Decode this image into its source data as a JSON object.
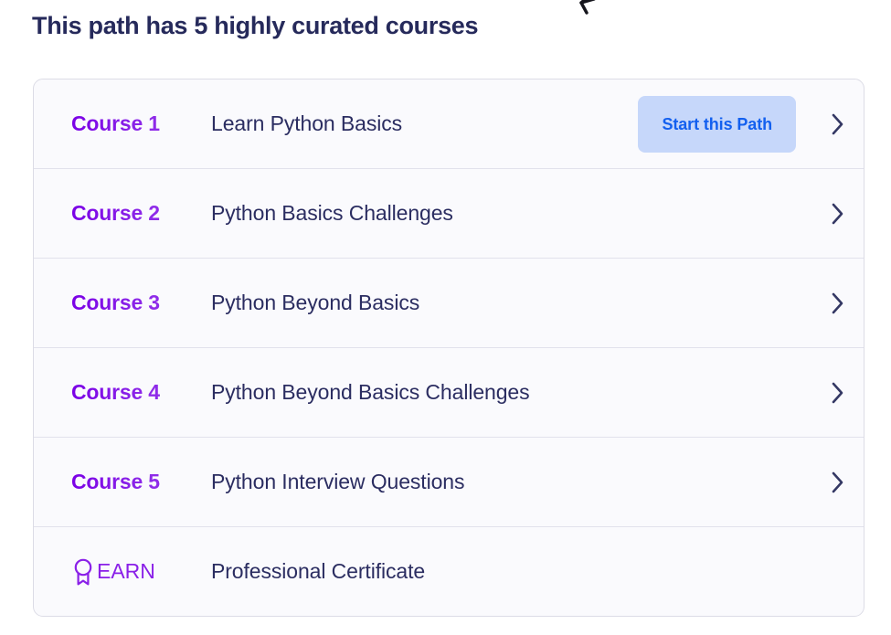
{
  "header": {
    "title": "This path has 5 highly curated courses",
    "decoration_icon": "curved-arrow-icon"
  },
  "colors": {
    "heading_navy": "#262a5b",
    "course_label_purple": "#7a00e6",
    "course_label_violet": "#9b30ee",
    "title_navy": "#2b2d61",
    "button_background": "#c6d7fa",
    "button_text": "#1360ef",
    "card_background": "#fafafd",
    "card_border": "#dcdce6",
    "row_divider": "#e2e2ec",
    "earn_icon_purple": "#8a20e8"
  },
  "course_list": {
    "rows": [
      {
        "label": "Course 1",
        "title": "Learn Python Basics",
        "button_label": "Start this Path",
        "has_button": true,
        "chevron_icon": "chevron-right-icon"
      },
      {
        "label": "Course 2",
        "title": "Python Basics Challenges",
        "button_label": "",
        "has_button": false,
        "chevron_icon": "chevron-right-icon"
      },
      {
        "label": "Course 3",
        "title": "Python Beyond Basics",
        "button_label": "",
        "has_button": false,
        "chevron_icon": "chevron-right-icon"
      },
      {
        "label": "Course 4",
        "title": "Python Beyond Basics Challenges",
        "button_label": "",
        "has_button": false,
        "chevron_icon": "chevron-right-icon"
      },
      {
        "label": "Course 5",
        "title": "Python Interview Questions",
        "button_label": "",
        "has_button": false,
        "chevron_icon": "chevron-right-icon"
      }
    ],
    "earn_row": {
      "label": "EARN",
      "title": "Professional Certificate",
      "icon": "award-medal-icon"
    }
  }
}
